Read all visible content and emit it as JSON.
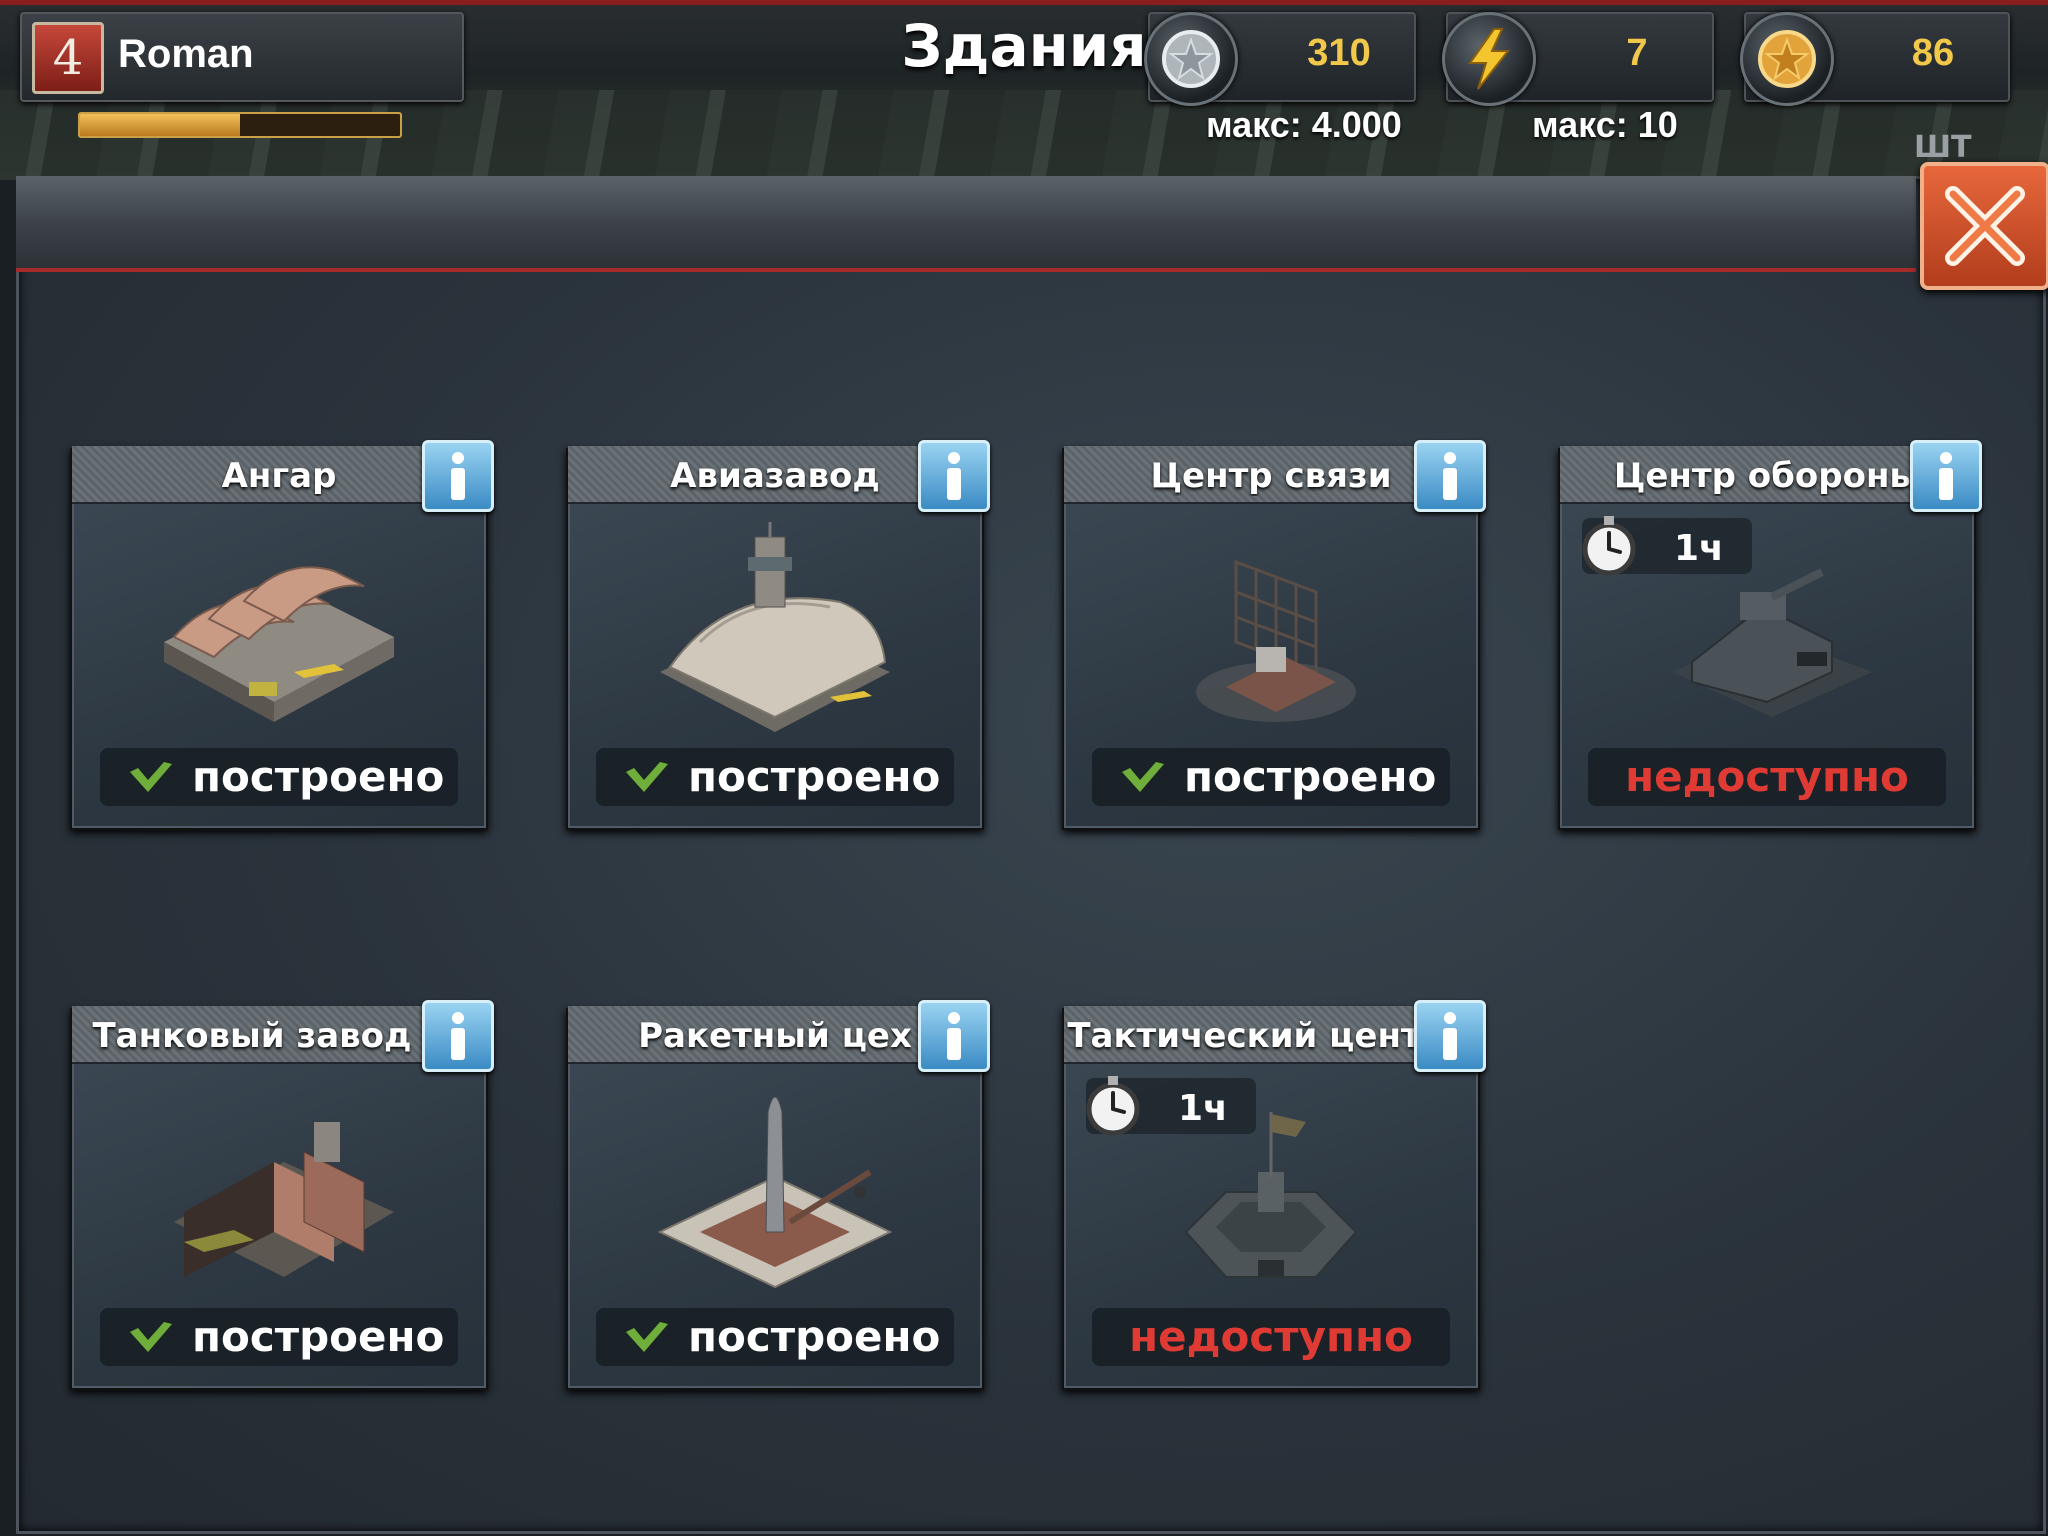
{
  "player": {
    "level": "4",
    "name": "Roman",
    "xp_progress": 0.5
  },
  "resources": [
    {
      "icon": "silver-star-coin-icon",
      "value": "310",
      "max": "макс: 4.000"
    },
    {
      "icon": "lightning-energy-icon",
      "value": "7",
      "max": "макс: 10"
    },
    {
      "icon": "gold-star-coin-icon",
      "value": "86",
      "max": ""
    }
  ],
  "hud_edge_label": "ШТ",
  "panel": {
    "title": "Здания",
    "close_icon": "close-x-icon"
  },
  "status_labels": {
    "built": "построено",
    "locked": "недоступно"
  },
  "colors": {
    "accent_red": "#a52a2a",
    "gold": "#f2c84b",
    "locked_text": "#e03a35",
    "check_green": "#6fae3a",
    "info_blue": "#3a8bc4"
  },
  "buildings": [
    {
      "name": "Ангар",
      "status": "построено",
      "state": "built",
      "timer": "",
      "icon": "hangar-building-icon"
    },
    {
      "name": "Авиазавод",
      "status": "построено",
      "state": "built",
      "timer": "",
      "icon": "aircraft-factory-icon"
    },
    {
      "name": "Центр связи",
      "status": "построено",
      "state": "built",
      "timer": "",
      "icon": "radar-comms-icon"
    },
    {
      "name": "Центр обороны",
      "status": "недоступно",
      "state": "locked",
      "timer": "1ч",
      "icon": "defense-bunker-icon"
    },
    {
      "name": "Танковый завод",
      "status": "построено",
      "state": "built",
      "timer": "",
      "icon": "tank-factory-icon"
    },
    {
      "name": "Ракетный цех",
      "status": "построено",
      "state": "built",
      "timer": "",
      "icon": "rocket-launch-pad-icon"
    },
    {
      "name": "Тактический цент",
      "status": "недоступно",
      "state": "locked",
      "timer": "1ч",
      "icon": "tactical-center-icon"
    }
  ]
}
